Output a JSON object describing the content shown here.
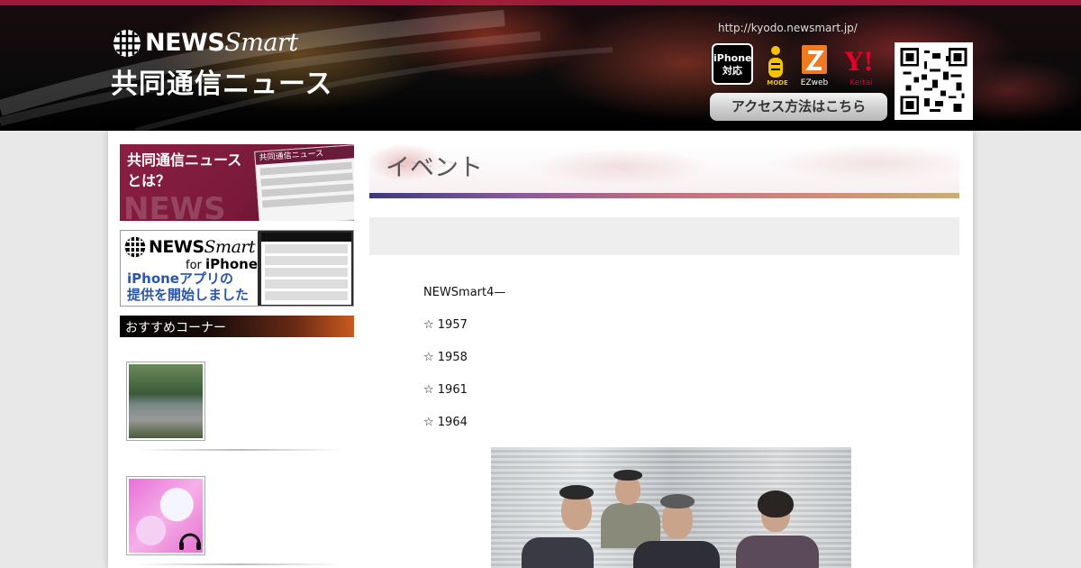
{
  "header": {
    "logo_main": "NEWS",
    "logo_italic": "Smart",
    "logo_sub": "共同通信ニュース",
    "url": "http://kyodo.newsmart.jp/",
    "iphone_badge_line1": "iPhone",
    "iphone_badge_line2": "対応",
    "imode_label": "MODE",
    "ezweb_label": "EZweb",
    "yahoo_logo": "Y!",
    "yahoo_label": "Keitai",
    "access_button": "アクセス方法はこちら"
  },
  "sidebar": {
    "banner1": {
      "line1": "共同通信ニュース",
      "line2": "とは？",
      "shot_title": "共同通信ニュース",
      "watermark": "NEWS"
    },
    "banner2": {
      "logo_main": "NEWS",
      "logo_italic": "Smart",
      "for_text": "for",
      "for_target": "iPhone",
      "msg_line1": "iPhoneアプリの",
      "msg_line2": "提供を開始しました"
    },
    "recommend_title": "おすすめコーナー"
  },
  "main": {
    "section_title": "イベント",
    "content_lines": [
      "NEWSmart4—",
      "☆ 1957",
      "☆ 1958",
      "☆ 1961",
      "☆ 1964"
    ]
  },
  "colors": {
    "header_top_bar": "#9a1a3a",
    "banner1_bg": "#8a1f44",
    "banner2_text": "#2a56a8",
    "page_bg": "#e8e8e8"
  }
}
